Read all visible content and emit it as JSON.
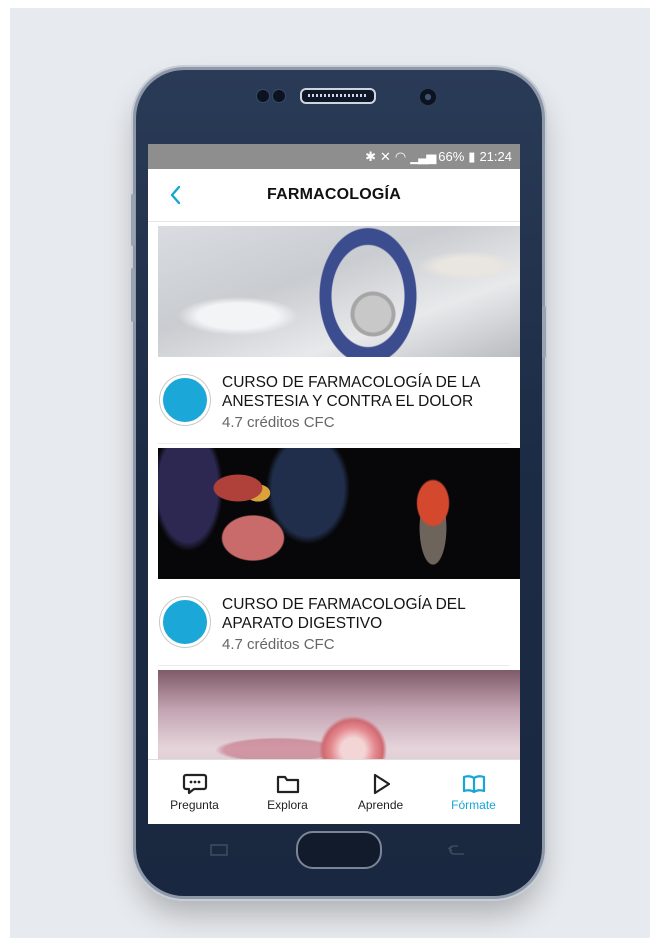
{
  "status_bar": {
    "icons": [
      "bluetooth-icon",
      "mute-icon",
      "wifi-icon",
      "signal-icon"
    ],
    "battery": "66%",
    "time": "21:24"
  },
  "header": {
    "title": "FARMACOLOGÍA",
    "back_icon": "chevron-left-icon"
  },
  "courses": [
    {
      "title_line1": "CURSO DE FARMACOLOGÍA DE LA",
      "title_line2": "ANESTESIA Y CONTRA EL DOLOR",
      "credits": "4.7 créditos CFC",
      "image": "anesthesia-mask-photo"
    },
    {
      "title_line1": "CURSO DE FARMACOLOGÍA DEL",
      "title_line2": "APARATO DIGESTIVO",
      "credits": "4.7 créditos CFC",
      "image": "digestive-system-illustration"
    },
    {
      "image": "cell-microscopy-illustration"
    }
  ],
  "nav": [
    {
      "label": "Pregunta",
      "icon": "chat-bubble-icon"
    },
    {
      "label": "Explora",
      "icon": "folder-icon"
    },
    {
      "label": "Aprende",
      "icon": "play-icon"
    },
    {
      "label": "Fórmate",
      "icon": "book-icon",
      "active": true
    }
  ],
  "colors": {
    "accent": "#15a6d5",
    "dot": "#1ba8d9",
    "status_bar": "#8e8e8e"
  }
}
